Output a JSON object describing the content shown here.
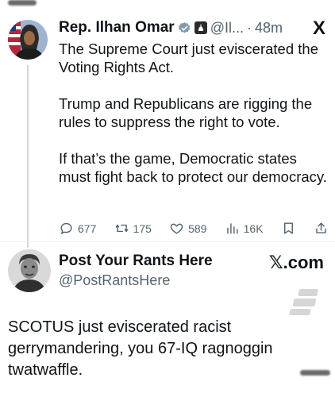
{
  "tweet": {
    "author_name": "Rep. Ilhan Omar",
    "handle": "@Il...",
    "separator": "·",
    "time": "48m",
    "platform_logo": "X",
    "body": [
      "The Supreme Court just eviscerated the Voting Rights Act.",
      "Trump and Republicans are rigging the rules to suppress the right to vote.",
      "If that’s the game, Democratic states must fight back to protect our democracy."
    ],
    "stats": {
      "replies": "677",
      "reposts": "175",
      "likes": "589",
      "views": "16K"
    },
    "icons": [
      "verified-badge-icon",
      "government-badge-icon",
      "reply-icon",
      "repost-icon",
      "like-icon",
      "views-icon",
      "bookmark-icon",
      "share-icon"
    ]
  },
  "reply": {
    "author_name": "Post Your Rants Here",
    "handle": "@PostRantsHere",
    "brand": "𝕏.com",
    "body": "SCOTUS just eviscerated racist gerrymandering, you 67-IQ ragnoggin twatwaffle."
  },
  "colors": {
    "text": "#0f1419",
    "secondary": "#536471",
    "verified": "#829aab",
    "thread_line": "#cfd9de"
  }
}
